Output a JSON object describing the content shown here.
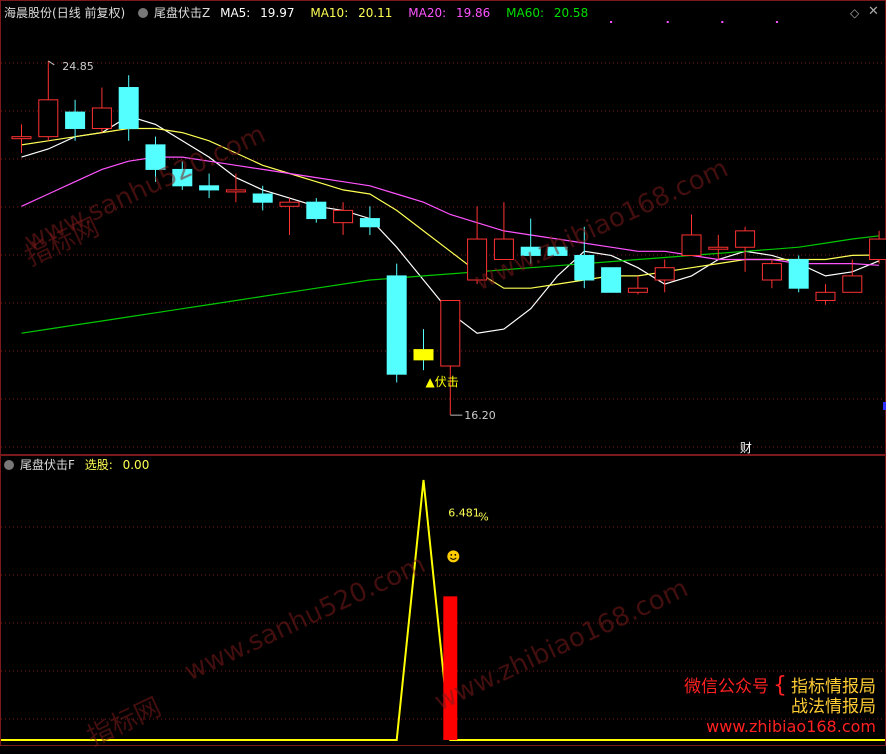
{
  "header_top": {
    "stock": "海晨股份",
    "period": "(日线 前复权)",
    "indicator": "尾盘伏击Z",
    "ma5_label": "MA5:",
    "ma5": "19.97",
    "ma10_label": "MA10:",
    "ma10": "20.11",
    "ma20_label": "MA20:",
    "ma20": "19.86",
    "ma60_label": "MA60:",
    "ma60": "20.58"
  },
  "header_bottom": {
    "indicator": "尾盘伏击F",
    "xg_label": "选股:",
    "xg": "0.00"
  },
  "colors": {
    "up": "#ff3232",
    "down": "#54ffff",
    "ma5": "#ffffff",
    "ma10": "#ffff54",
    "ma20": "#ff54ff",
    "ma60": "#00c800",
    "grid": "#7a1a1a",
    "signal": "#ffff00",
    "bar": "#ff0000"
  },
  "price_chart": {
    "high_label": "24.85",
    "low_label": "16.20",
    "signal_label": "▲伏击",
    "finance_label": "财",
    "ymin": 15.3,
    "ymax": 25.8
  },
  "chart_data": [
    {
      "type": "candlestick",
      "title": "尾盘伏击Z",
      "candles": [
        {
          "o": 23.0,
          "c": 23.0,
          "h": 23.3,
          "l": 22.6
        },
        {
          "o": 23.0,
          "c": 23.9,
          "h": 24.85,
          "l": 22.9
        },
        {
          "o": 23.6,
          "c": 23.2,
          "h": 23.9,
          "l": 22.9
        },
        {
          "o": 23.2,
          "c": 23.7,
          "h": 24.2,
          "l": 23.1
        },
        {
          "o": 24.2,
          "c": 23.2,
          "h": 24.5,
          "l": 22.9
        },
        {
          "o": 22.8,
          "c": 22.2,
          "h": 23.0,
          "l": 21.9
        },
        {
          "o": 22.2,
          "c": 21.8,
          "h": 22.4,
          "l": 21.7
        },
        {
          "o": 21.8,
          "c": 21.7,
          "h": 22.1,
          "l": 21.5
        },
        {
          "o": 21.7,
          "c": 21.7,
          "h": 22.1,
          "l": 21.4
        },
        {
          "o": 21.6,
          "c": 21.4,
          "h": 21.8,
          "l": 21.2
        },
        {
          "o": 21.3,
          "c": 21.4,
          "h": 21.5,
          "l": 20.6
        },
        {
          "o": 21.4,
          "c": 21.0,
          "h": 21.5,
          "l": 20.9
        },
        {
          "o": 20.9,
          "c": 21.2,
          "h": 21.4,
          "l": 20.6
        },
        {
          "o": 21.0,
          "c": 20.8,
          "h": 21.3,
          "l": 20.6
        },
        {
          "o": 19.6,
          "c": 17.2,
          "h": 19.9,
          "l": 17.0
        },
        {
          "o": 17.8,
          "c": 17.55,
          "h": 18.3,
          "l": 17.3
        },
        {
          "o": 17.4,
          "c": 19.0,
          "h": 19.0,
          "l": 16.2
        },
        {
          "o": 19.5,
          "c": 20.5,
          "h": 21.3,
          "l": 19.4
        },
        {
          "o": 20.0,
          "c": 20.5,
          "h": 21.4,
          "l": 20.0
        },
        {
          "o": 20.3,
          "c": 20.1,
          "h": 21.0,
          "l": 19.9
        },
        {
          "o": 20.3,
          "c": 20.1,
          "h": 20.3,
          "l": 20.1
        },
        {
          "o": 20.1,
          "c": 19.5,
          "h": 20.8,
          "l": 19.3
        },
        {
          "o": 19.8,
          "c": 19.2,
          "h": 19.8,
          "l": 19.2
        },
        {
          "o": 19.2,
          "c": 19.3,
          "h": 19.6,
          "l": 19.15
        },
        {
          "o": 19.5,
          "c": 19.8,
          "h": 20.0,
          "l": 19.2
        },
        {
          "o": 20.1,
          "c": 20.6,
          "h": 21.1,
          "l": 20.1
        },
        {
          "o": 20.3,
          "c": 20.3,
          "h": 20.6,
          "l": 20.0
        },
        {
          "o": 20.3,
          "c": 20.7,
          "h": 20.8,
          "l": 19.7
        },
        {
          "o": 19.5,
          "c": 19.9,
          "h": 20.0,
          "l": 19.3
        },
        {
          "o": 20.0,
          "c": 19.3,
          "h": 20.1,
          "l": 19.2
        },
        {
          "o": 19.0,
          "c": 19.2,
          "h": 19.4,
          "l": 18.9
        },
        {
          "o": 19.2,
          "c": 19.6,
          "h": 20.0,
          "l": 19.2
        },
        {
          "o": 20.0,
          "c": 20.5,
          "h": 20.7,
          "l": 19.9
        }
      ],
      "ma_series": [
        {
          "name": "MA5",
          "values": [
            22.5,
            22.7,
            23.0,
            23.1,
            23.5,
            23.3,
            22.9,
            22.5,
            22.0,
            21.7,
            21.5,
            21.3,
            21.2,
            21.0,
            20.3,
            19.5,
            18.7,
            18.2,
            18.3,
            18.8,
            19.6,
            20.2,
            20.1,
            19.8,
            19.4,
            19.6,
            20.0,
            20.2,
            20.1,
            19.9,
            19.6,
            19.7,
            19.97
          ]
        },
        {
          "name": "MA10",
          "values": [
            22.8,
            22.9,
            23.0,
            23.1,
            23.2,
            23.2,
            23.1,
            22.9,
            22.6,
            22.3,
            22.1,
            21.9,
            21.7,
            21.6,
            21.2,
            20.7,
            20.2,
            19.7,
            19.3,
            19.3,
            19.4,
            19.5,
            19.6,
            19.6,
            19.7,
            19.8,
            19.9,
            20.0,
            20.0,
            20.0,
            20.0,
            20.1,
            20.11
          ]
        },
        {
          "name": "MA20",
          "values": [
            21.3,
            21.6,
            21.9,
            22.2,
            22.4,
            22.5,
            22.5,
            22.4,
            22.3,
            22.2,
            22.1,
            22.0,
            21.9,
            21.8,
            21.6,
            21.4,
            21.1,
            20.9,
            20.7,
            20.6,
            20.5,
            20.4,
            20.3,
            20.2,
            20.2,
            20.1,
            20.0,
            20.0,
            20.0,
            19.9,
            19.9,
            19.9,
            19.86
          ]
        },
        {
          "name": "MA60",
          "values": [
            18.2,
            18.3,
            18.4,
            18.5,
            18.6,
            18.7,
            18.8,
            18.9,
            19.0,
            19.1,
            19.2,
            19.3,
            19.4,
            19.5,
            19.55,
            19.6,
            19.65,
            19.7,
            19.75,
            19.8,
            19.85,
            19.9,
            19.95,
            20.0,
            20.05,
            20.1,
            20.15,
            20.2,
            20.25,
            20.3,
            20.4,
            20.5,
            20.58
          ]
        }
      ]
    },
    {
      "type": "line",
      "title": "尾盘伏击F",
      "series": [
        {
          "name": "选股",
          "values": [
            0,
            0,
            0,
            0,
            0,
            0,
            0,
            0,
            0,
            0,
            0,
            0,
            0,
            0,
            0,
            1,
            0,
            0,
            0,
            0,
            0,
            0,
            0,
            0,
            0,
            0,
            0,
            0,
            0,
            0,
            0,
            0,
            0
          ]
        }
      ],
      "bar_value": 6.481,
      "bar_index": 16,
      "bar_label": "6.481",
      "bar_unit": "%"
    }
  ],
  "watermarks": [
    "www.sanhu520.com",
    "www.zhibiao168.com",
    "指标网",
    "www.zhibiao168.com",
    "www.sanhu520.com",
    "指标网"
  ],
  "promo": {
    "line1_a": "微信公众号",
    "line1_b": "指标情报局",
    "line2": "战法情报局",
    "url": "www.zhibiao168.com"
  }
}
